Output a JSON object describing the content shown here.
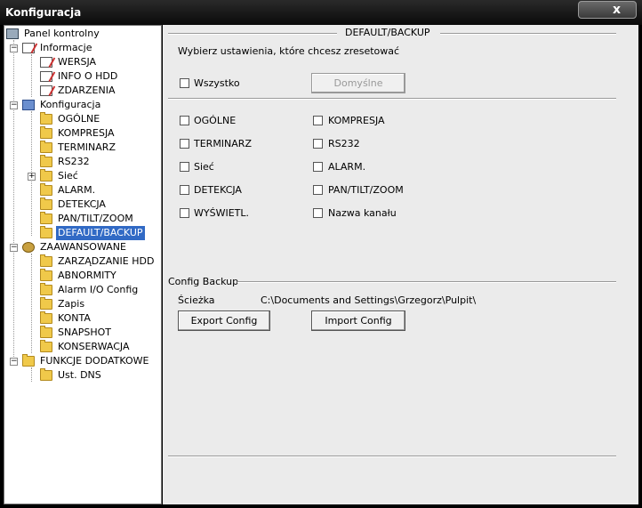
{
  "window": {
    "title": "Konfiguracja",
    "close_label": "x"
  },
  "tree": {
    "root": "Panel kontrolny",
    "informacje": {
      "label": "Informacje",
      "children": [
        "WERSJA",
        "INFO O HDD",
        "ZDARZENIA"
      ]
    },
    "konfiguracja": {
      "label": "Konfiguracja",
      "children": [
        "OGÓLNE",
        "KOMPRESJA",
        "TERMINARZ",
        "RS232",
        "Sieć",
        "ALARM.",
        "DETEKCJA",
        "PAN/TILT/ZOOM",
        "DEFAULT/BACKUP"
      ]
    },
    "zaawansowane": {
      "label": "ZAAWANSOWANE",
      "children": [
        "ZARZĄDZANIE HDD",
        "ABNORMITY",
        "Alarm I/O Config",
        "Zapis",
        "KONTA",
        "SNAPSHOT",
        "KONSERWACJA"
      ]
    },
    "funkcje": {
      "label": "FUNKCJE DODATKOWE",
      "children": [
        "Ust. DNS"
      ]
    },
    "selected": "DEFAULT/BACKUP"
  },
  "panel": {
    "section_title": "DEFAULT/BACKUP",
    "instruction": "Wybierz ustawienia, które chcesz zresetować",
    "all_label": "Wszystko",
    "default_button": "Domyślne",
    "options_left": [
      "OGÓLNE",
      "TERMINARZ",
      "Sieć",
      "DETEKCJA",
      "WYŚWIETL."
    ],
    "options_right": [
      "KOMPRESJA",
      "RS232",
      "ALARM.",
      "PAN/TILT/ZOOM",
      "Nazwa kanału"
    ],
    "backup_title": "Config Backup",
    "path_label": "Ścieżka",
    "path_value": "C:\\Documents and Settings\\Grzegorz\\Pulpit\\",
    "export_button": "Export Config",
    "import_button": "Import Config"
  }
}
